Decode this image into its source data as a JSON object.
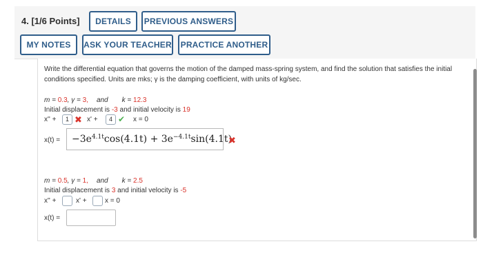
{
  "question": {
    "title": "4.  [1/6 Points]"
  },
  "toolbar": {
    "details": "DETAILS",
    "previous_answers": "PREVIOUS ANSWERS",
    "my_notes": "MY NOTES",
    "ask_teacher": "ASK YOUR TEACHER",
    "practice_another": "PRACTICE ANOTHER"
  },
  "prompt": "Write the differential equation that governs the motion of the damped mass-spring system, and find the solution that satisfies the initial conditions specified. Units are mks; γ is the damping coefficient, with units of kg/sec.",
  "part1": {
    "m_label": "m = ",
    "m": "0.3",
    "gamma_label": ",  γ = ",
    "gamma": "3,",
    "and": "and",
    "k_label": "k = ",
    "k": "12.3",
    "disp_text": "Initial displacement is ",
    "disp": "-3",
    "vel_text": " and initial velocity is ",
    "vel": "19",
    "eq_a": "x'' +",
    "box1": "1",
    "eq_b": "x' +",
    "box2": "4",
    "eq_c": "x = 0",
    "xt_label": "x(t) =",
    "x_answer": "−3e^{4.1t} cos(4.1t) + 3e^{−4.1t} sin(4.1t)",
    "ans_coef1": "−3e",
    "ans_exp1": "4.1t",
    "ans_mid": "cos(4.1t) + 3e",
    "ans_exp2": "−4.1t",
    "ans_end": "sin(4.1t)"
  },
  "part2": {
    "m_label": "m = ",
    "m": "0.5",
    "gamma_label": ",  γ = ",
    "gamma": "1,",
    "and": "and",
    "k_label": "k = ",
    "k": "2.5",
    "disp_text": "Initial displacement is ",
    "disp": "3",
    "vel_text": " and initial velocity is ",
    "vel": "-5",
    "eq_a": "x'' +",
    "box1": "",
    "eq_b": "x' +",
    "box2": "",
    "eq_c": "x = 0",
    "xt_label": "x(t) =",
    "x_answer": ""
  },
  "colors": {
    "accent": "#2f5d8a",
    "incorrect": "#d9332b",
    "correct": "#4caf50",
    "given_value": "#d9332b"
  }
}
